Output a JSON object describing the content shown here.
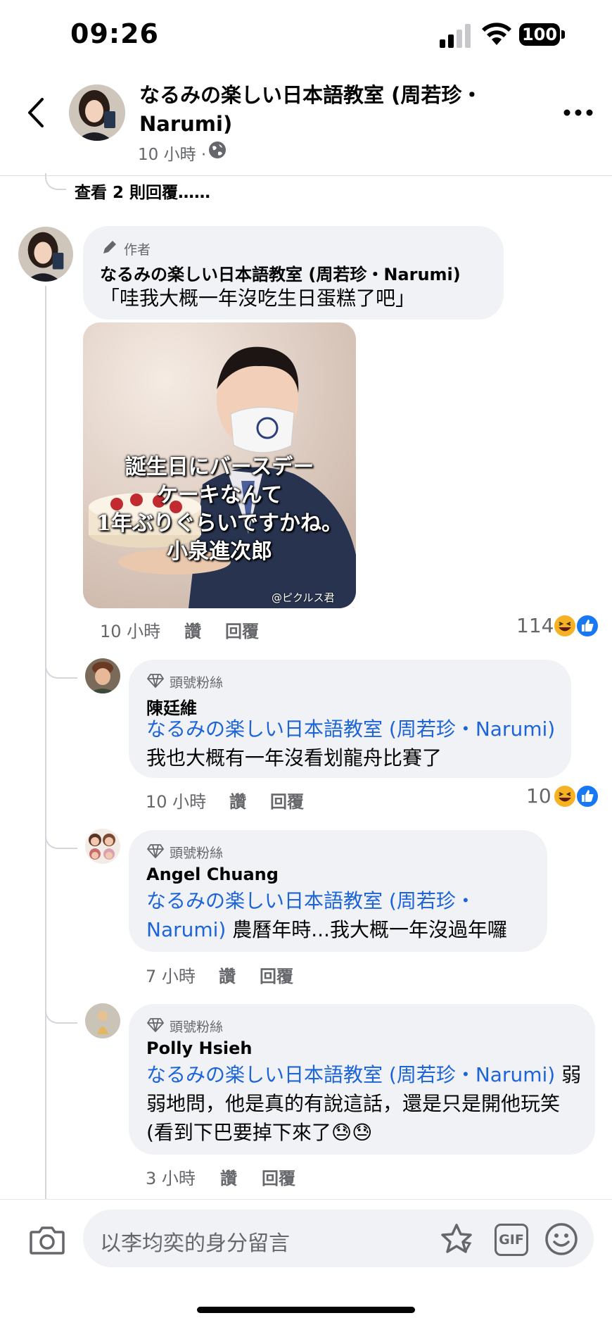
{
  "status_bar": {
    "time": "09:26",
    "battery": "100"
  },
  "header": {
    "title": "なるみの楽しい日本語教室 (周若珍・Narumi)",
    "meta": "10 小時 ·"
  },
  "view_more_replies": "查看 2 則回覆……",
  "author_comment": {
    "badge": "作者",
    "name": "なるみの楽しい日本語教室 (周若珍・Narumi)",
    "text": "「哇我大概一年沒吃生日蛋糕了吧」",
    "image_caption": [
      "誕生日にバースデー",
      "ケーキなんて",
      "1年ぶりぐらいですかね。",
      "小泉進次郎"
    ],
    "image_watermark": "@ピクルス君",
    "time": "10 小時",
    "like": "讚",
    "reply": "回覆",
    "reaction_count": "114"
  },
  "replies": [
    {
      "badge": "頭號粉絲",
      "name": "陳廷維",
      "mention": "なるみの楽しい日本語教室 (周若珍・Narumi)",
      "text": "我也大概有一年沒看划龍舟比賽了",
      "time": "10 小時",
      "like": "讚",
      "reply": "回覆",
      "reaction_count": "10"
    },
    {
      "badge": "頭號粉絲",
      "name": "Angel Chuang",
      "mention": "なるみの楽しい日本語教室 (周若珍・Narumi)",
      "text": "農曆年時...我大概一年沒過年囉",
      "time": "7 小時",
      "like": "讚",
      "reply": "回覆"
    },
    {
      "badge": "頭號粉絲",
      "name": "Polly Hsieh",
      "mention": "なるみの楽しい日本語教室 (周若珍・Narumi)",
      "text": "弱弱地問，他是真的有說這話，還是只是開他玩笑 (看到下巴要掉下來了😓😓",
      "time": "3 小時",
      "like": "讚",
      "reply": "回覆"
    }
  ],
  "composer": {
    "placeholder": "以李均奕的身分留言",
    "gif_label": "GIF"
  },
  "colors": {
    "link": "#1d64d8",
    "bubble": "#f0f2f5",
    "like_blue": "#1877f2",
    "haha_yellow": "#f7b125"
  }
}
